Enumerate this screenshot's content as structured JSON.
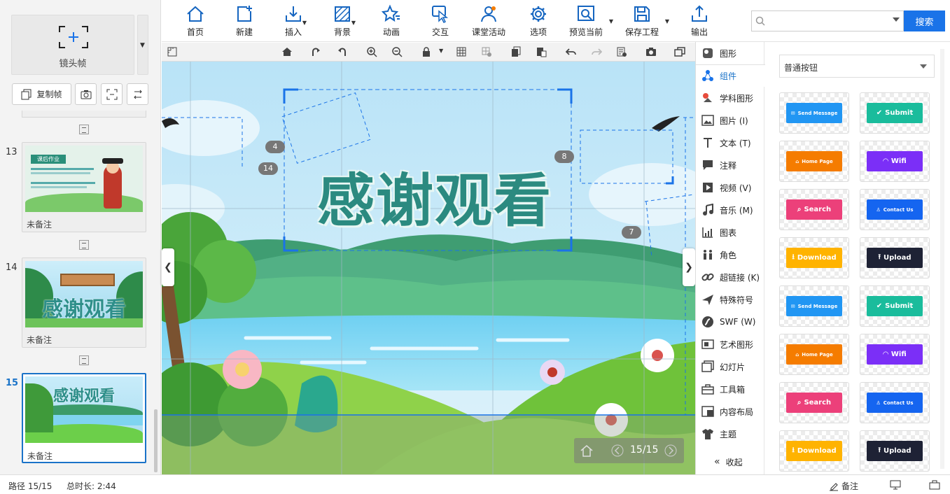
{
  "left_panel": {
    "lens_frame_label": "镜头帧",
    "copy_frame_label": "复制帧",
    "slides": [
      {
        "number": "13",
        "note": "未备注",
        "thumb_title": "课后作业"
      },
      {
        "number": "14",
        "note": "未备注",
        "thumb_title": "感谢观看"
      },
      {
        "number": "15",
        "note": "未备注",
        "thumb_title": "感谢观看"
      }
    ]
  },
  "toolbar": {
    "items": [
      {
        "label": "首页",
        "icon": "home-icon"
      },
      {
        "label": "新建",
        "icon": "new-icon"
      },
      {
        "label": "插入",
        "icon": "insert-icon"
      },
      {
        "label": "背景",
        "icon": "background-icon"
      },
      {
        "label": "动画",
        "icon": "animation-icon"
      },
      {
        "label": "交互",
        "icon": "interact-icon"
      },
      {
        "label": "课堂活动",
        "icon": "classroom-icon"
      },
      {
        "label": "选项",
        "icon": "gear-icon"
      },
      {
        "label": "预览当前",
        "icon": "preview-icon"
      },
      {
        "label": "保存工程",
        "icon": "save-icon"
      },
      {
        "label": "输出",
        "icon": "export-icon"
      }
    ],
    "search_placeholder": "",
    "search_button": "搜索"
  },
  "canvas": {
    "title_text": "感谢观看",
    "frame_badges": [
      "4",
      "14",
      "8",
      "7"
    ],
    "pager_text": "15/15"
  },
  "side_menu": {
    "items": [
      {
        "label": "图形",
        "icon": "shape-icon"
      },
      {
        "label": "组件",
        "icon": "component-icon",
        "selected": true
      },
      {
        "label": "学科图形",
        "icon": "subject-shape-icon"
      },
      {
        "label": "图片 (I)",
        "icon": "image-icon"
      },
      {
        "label": "文本 (T)",
        "icon": "text-icon"
      },
      {
        "label": "注释",
        "icon": "comment-icon"
      },
      {
        "label": "视频 (V)",
        "icon": "video-icon"
      },
      {
        "label": "音乐 (M)",
        "icon": "music-icon"
      },
      {
        "label": "图表",
        "icon": "chart-icon"
      },
      {
        "label": "角色",
        "icon": "role-icon"
      },
      {
        "label": "超链接 (K)",
        "icon": "link-icon"
      },
      {
        "label": "特殊符号",
        "icon": "plane-icon"
      },
      {
        "label": "SWF (W)",
        "icon": "swf-icon"
      },
      {
        "label": "艺术图形",
        "icon": "art-shape-icon"
      },
      {
        "label": "幻灯片",
        "icon": "slideshow-icon"
      },
      {
        "label": "工具箱",
        "icon": "toolbox-icon"
      },
      {
        "label": "内容布局",
        "icon": "layout-icon"
      },
      {
        "label": "主题",
        "icon": "theme-icon"
      }
    ],
    "collapse_label": "收起"
  },
  "components": {
    "category": "普通按钮",
    "buttons": [
      {
        "label": "Send Message",
        "color": "#2196f3",
        "icon": "mail-icon"
      },
      {
        "label": "Submit",
        "color": "#1abc9c",
        "icon": "check-icon"
      },
      {
        "label": "Home Page",
        "color": "#f57c00",
        "icon": "home-icon"
      },
      {
        "label": "Wifi",
        "color": "#7b2ff7",
        "icon": "wifi-icon"
      },
      {
        "label": "Search",
        "color": "#ec407a",
        "icon": "search-icon"
      },
      {
        "label": "Contact Us",
        "color": "#1565f0",
        "icon": "user-icon"
      },
      {
        "label": "Download",
        "color": "#ffb300",
        "icon": "download-icon"
      },
      {
        "label": "Upload",
        "color": "#1e2235",
        "icon": "upload-icon"
      },
      {
        "label": "Send Message",
        "color": "#2196f3",
        "icon": "mail-icon"
      },
      {
        "label": "Submit",
        "color": "#1abc9c",
        "icon": "check-icon"
      },
      {
        "label": "Home Page",
        "color": "#f57c00",
        "icon": "home-icon"
      },
      {
        "label": "Wifi",
        "color": "#7b2ff7",
        "icon": "wifi-icon"
      },
      {
        "label": "Search",
        "color": "#ec407a",
        "icon": "search-icon"
      },
      {
        "label": "Contact Us",
        "color": "#1565f0",
        "icon": "user-icon"
      },
      {
        "label": "Download",
        "color": "#ffb300",
        "icon": "download-icon"
      },
      {
        "label": "Upload",
        "color": "#1e2235",
        "icon": "upload-icon"
      }
    ]
  },
  "status_bar": {
    "path": "路径 15/15",
    "duration": "总时长: 2:44",
    "note_label": "备注"
  }
}
